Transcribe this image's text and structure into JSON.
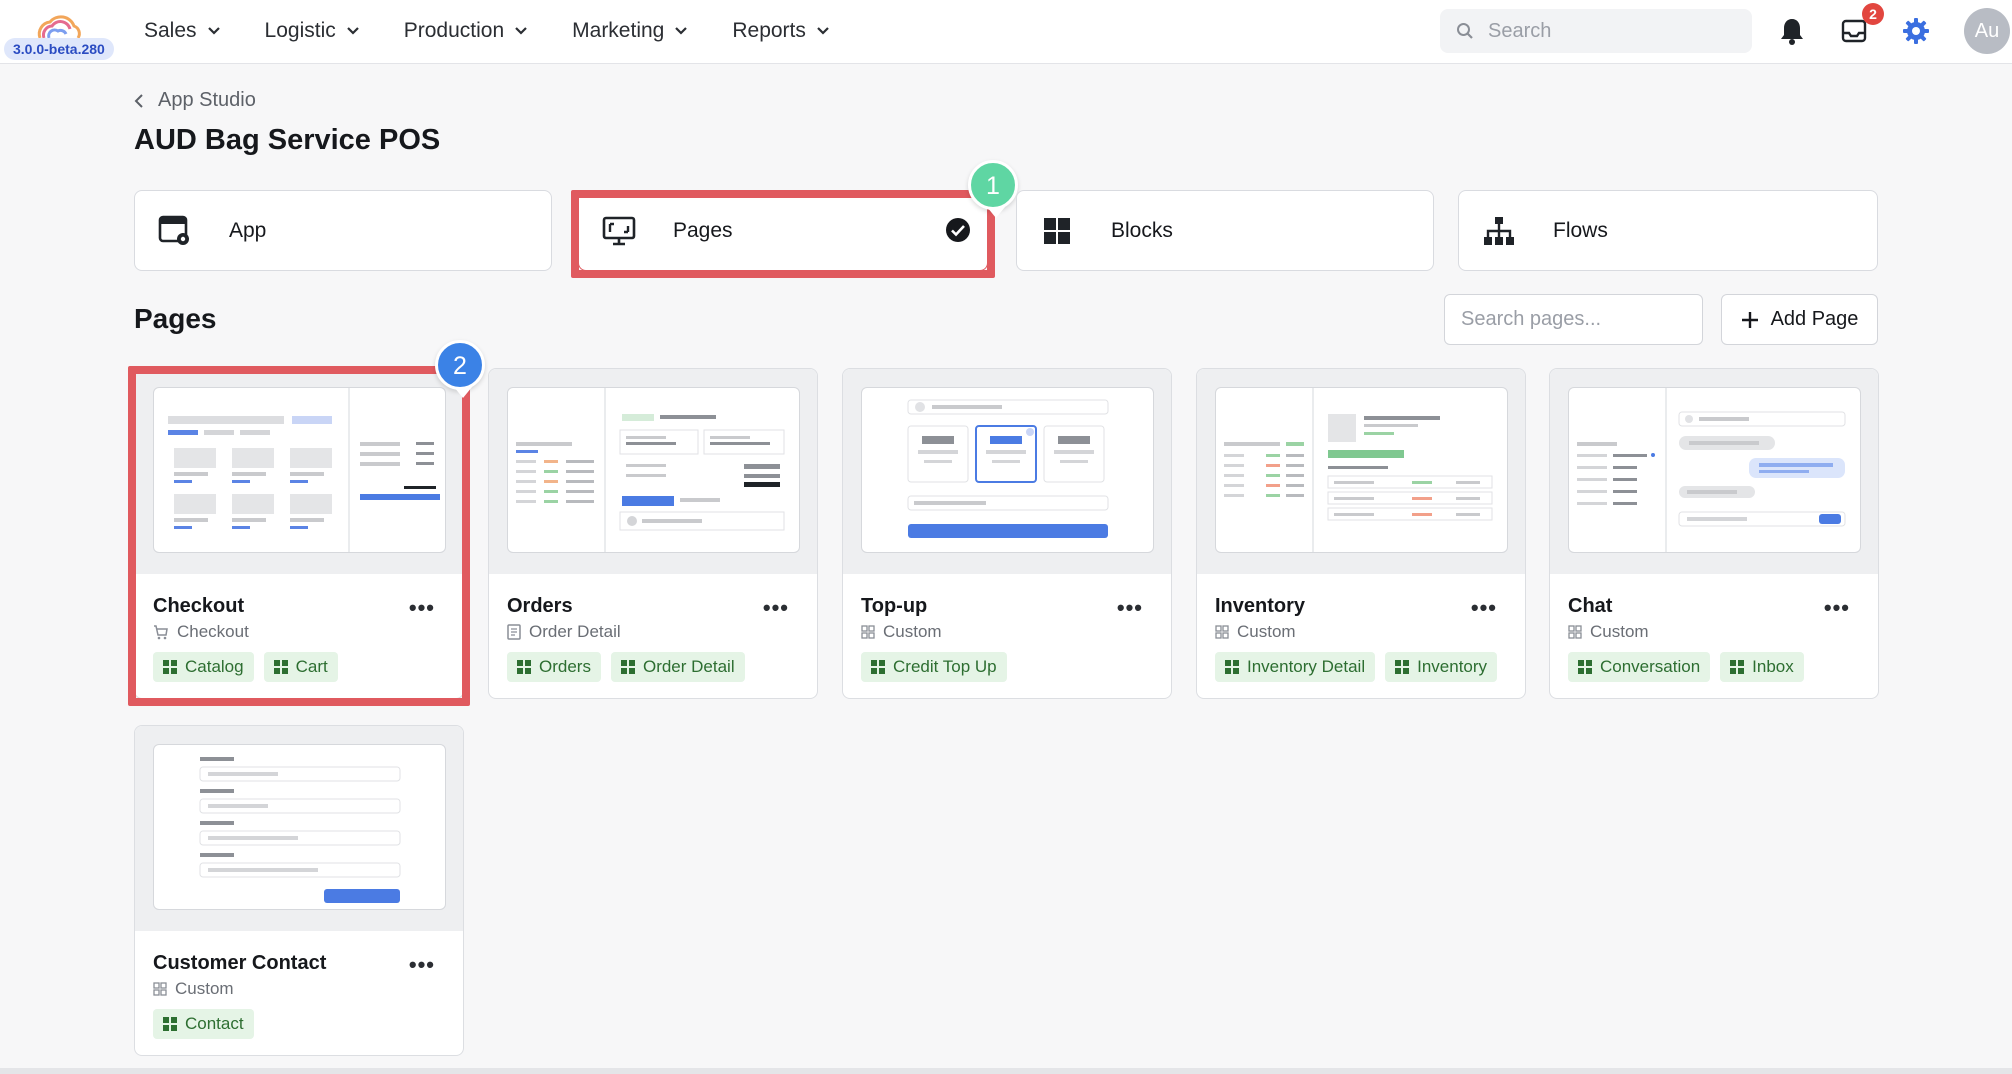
{
  "app": {
    "version": "3.0.0-beta.280",
    "notification_count": "2",
    "avatar_initials": "Au"
  },
  "nav": [
    {
      "label": "Sales"
    },
    {
      "label": "Logistic"
    },
    {
      "label": "Production"
    },
    {
      "label": "Marketing"
    },
    {
      "label": "Reports"
    }
  ],
  "search": {
    "placeholder": "Search"
  },
  "breadcrumb": {
    "label": "App Studio"
  },
  "page_title": "AUD Bag Service POS",
  "sections": [
    {
      "label": "App",
      "icon": "app-settings-icon"
    },
    {
      "label": "Pages",
      "icon": "monitor-icon",
      "selected": true
    },
    {
      "label": "Blocks",
      "icon": "grid-icon"
    },
    {
      "label": "Flows",
      "icon": "sitemap-icon"
    }
  ],
  "markers": {
    "step1": "1",
    "step2": "2"
  },
  "pages_section": {
    "title": "Pages",
    "search_placeholder": "Search pages...",
    "add_label": "Add Page"
  },
  "cards": [
    {
      "title": "Checkout",
      "type": "Checkout",
      "type_icon": "cart-icon",
      "tags": [
        "Catalog",
        "Cart"
      ]
    },
    {
      "title": "Orders",
      "type": "Order Detail",
      "type_icon": "document-icon",
      "tags": [
        "Orders",
        "Order Detail"
      ]
    },
    {
      "title": "Top-up",
      "type": "Custom",
      "type_icon": "custom-grid-icon",
      "tags": [
        "Credit Top Up"
      ]
    },
    {
      "title": "Inventory",
      "type": "Custom",
      "type_icon": "custom-grid-icon",
      "tags": [
        "Inventory Detail",
        "Inventory"
      ]
    },
    {
      "title": "Chat",
      "type": "Custom",
      "type_icon": "custom-grid-icon",
      "tags": [
        "Conversation",
        "Inbox"
      ]
    },
    {
      "title": "Customer Contact",
      "type": "Custom",
      "type_icon": "custom-grid-icon",
      "tags": [
        "Contact"
      ]
    }
  ],
  "colors": {
    "accent": "#3b82e6",
    "highlight": "#e05a5f",
    "marker_green": "#5fd6a3",
    "tag_bg": "#e5f4e6",
    "tag_text": "#2d6e31"
  }
}
